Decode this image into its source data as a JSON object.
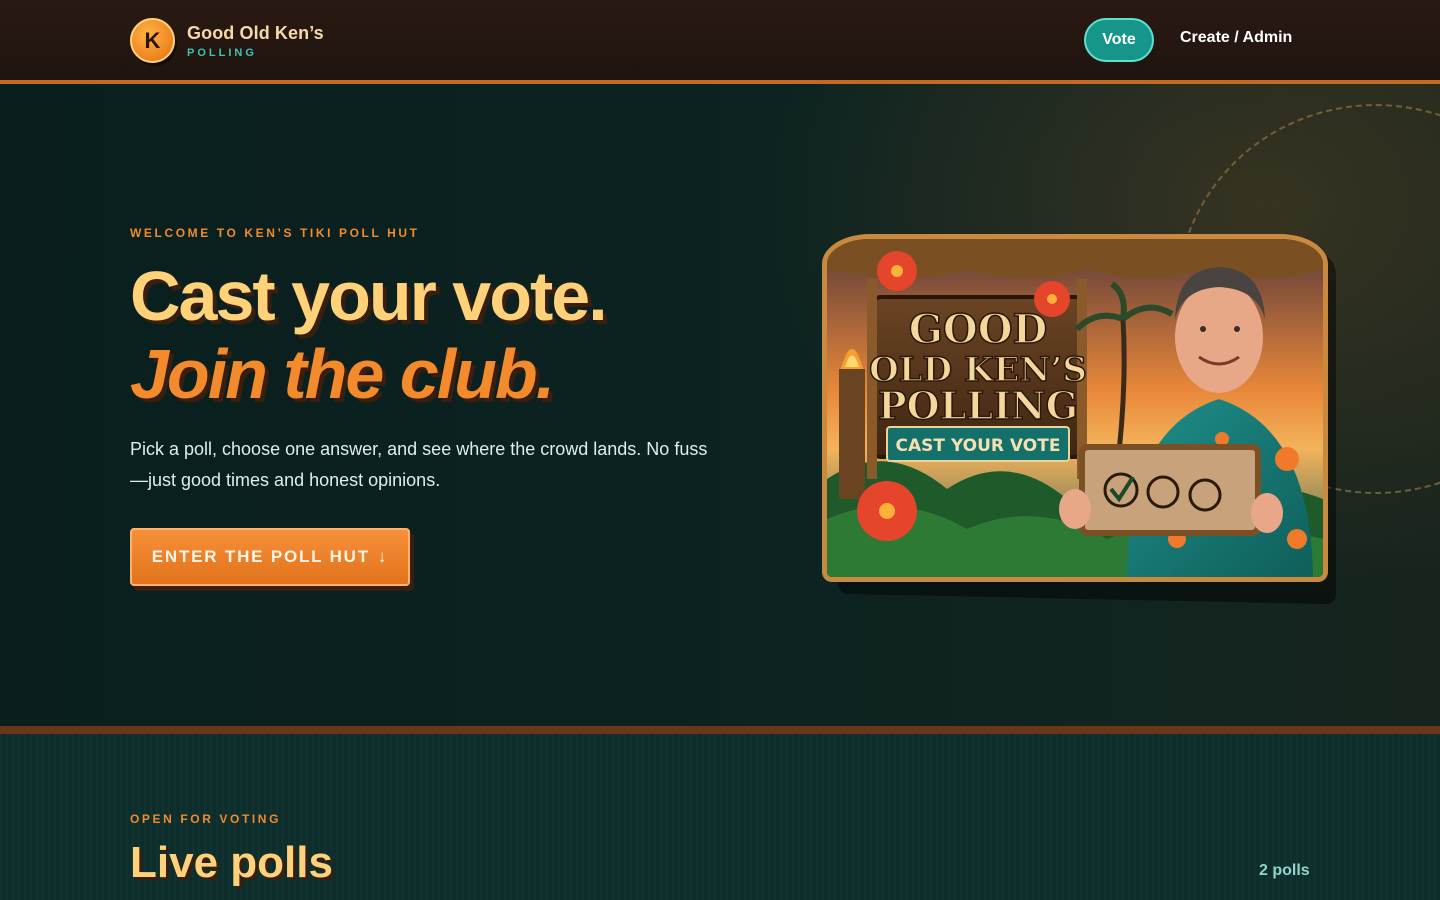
{
  "header": {
    "logo_letter": "K",
    "brand_name": "Good Old Ken’s",
    "brand_sub": "POLLING",
    "nav": {
      "vote_label": "Vote",
      "admin_label": "Create / Admin"
    }
  },
  "hero": {
    "eyebrow": "WELCOME TO KEN’S TIKI POLL HUT",
    "headline_line1": "Cast your vote.",
    "headline_line2": "Join the club.",
    "description": "Pick a poll, choose one answer, and see where the crowd lands. No fuss—just good times and honest opinions.",
    "cta_label": "ENTER THE POLL HUT",
    "cta_arrow": "↓",
    "art": {
      "sign_line1": "GOOD",
      "sign_line2": "OLD KEN’S",
      "sign_line3": "POLLING",
      "banner": "CAST YOUR VOTE"
    }
  },
  "polls": {
    "eyebrow": "OPEN FOR VOTING",
    "title": "Live polls",
    "count": "2 polls"
  },
  "colors": {
    "accent_orange": "#f38a2c",
    "accent_gold": "#ffd27a",
    "accent_teal": "#16958a",
    "header_bg": "#1f140f",
    "hero_bg": "#0b2422"
  }
}
